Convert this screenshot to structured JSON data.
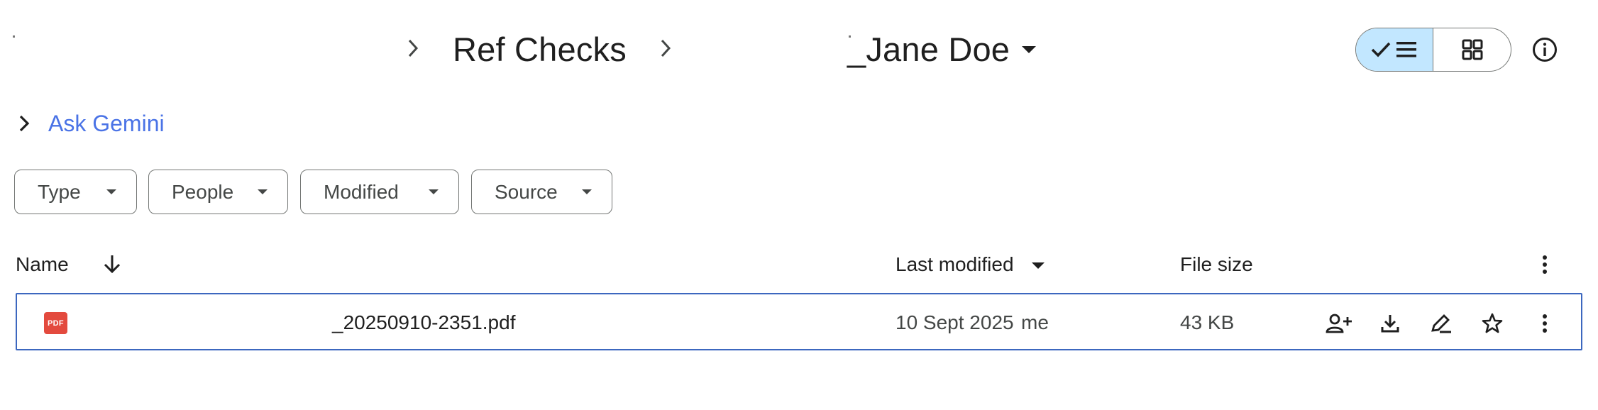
{
  "breadcrumb": {
    "parent": "Ref Checks",
    "current": "_Jane Doe"
  },
  "view_toggle": {
    "list_icon": "check-list-icon",
    "grid_icon": "grid-icon"
  },
  "gemini": {
    "label": "Ask Gemini"
  },
  "filters": [
    {
      "label": "Type"
    },
    {
      "label": "People"
    },
    {
      "label": "Modified"
    },
    {
      "label": "Source"
    }
  ],
  "table": {
    "headers": {
      "name": "Name",
      "last_modified": "Last modified",
      "file_size": "File size"
    },
    "rows": [
      {
        "icon_label": "PDF",
        "name": "_20250910-2351.pdf",
        "modified_date": "10 Sept 2025",
        "modified_by": "me",
        "size": "43 KB",
        "actions": [
          "share-icon",
          "download-icon",
          "rename-icon",
          "star-icon",
          "more-vert-icon"
        ]
      }
    ]
  },
  "colors": {
    "accent": "#4a73e6",
    "toggle_active": "#c2e7ff",
    "row_selected_border": "#3c67bf",
    "pdf": "#e34a3e"
  }
}
